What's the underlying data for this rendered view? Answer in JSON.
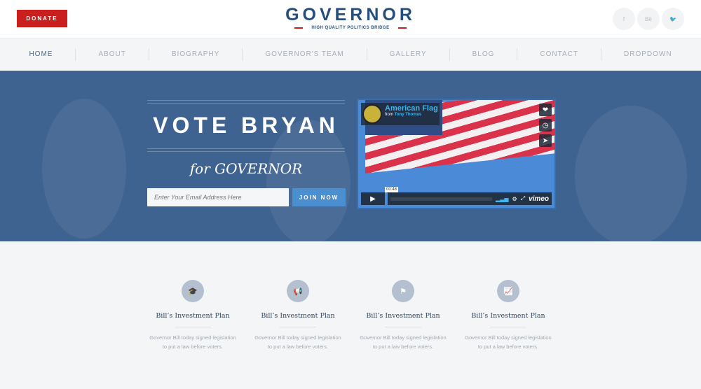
{
  "header": {
    "donate": "DONATE",
    "logo_title": "GOVERNOR",
    "logo_sub": "HIGH QUALITY POLITICS BRIDGE",
    "social": [
      {
        "icon": "facebook-icon",
        "glyph": "f"
      },
      {
        "icon": "behance-icon",
        "glyph": "Bē"
      },
      {
        "icon": "twitter-icon",
        "glyph": "🐦"
      }
    ]
  },
  "nav": [
    "HOME",
    "ABOUT",
    "BIOGRAPHY",
    "GOVERNOR'S TEAM",
    "GALLERY",
    "BLOG",
    "CONTACT",
    "DROPDOWN"
  ],
  "hero": {
    "title": "VOTE BRYAN",
    "subtitle": "for GOVERNOR",
    "email_placeholder": "Enter Your Email Address Here",
    "join": "JOIN NOW"
  },
  "video": {
    "title": "American Flag",
    "from": "from",
    "author": "Tony Thomas",
    "time": "00:48",
    "brand": "vimeo"
  },
  "features": [
    {
      "icon": "graduation-cap-icon",
      "glyph": "🎓",
      "title": "Bill’s Investment Plan",
      "text": "Governor Bill today signed legislation to put a law before voters."
    },
    {
      "icon": "megaphone-icon",
      "glyph": "📢",
      "title": "Bill’s Investment Plan",
      "text": "Governor Bill today signed legislation to put a law before voters."
    },
    {
      "icon": "flag-icon",
      "glyph": "⚑",
      "title": "Bill’s Investment Plan",
      "text": "Governor Bill today signed legislation to put a law before voters."
    },
    {
      "icon": "chart-line-icon",
      "glyph": "📈",
      "title": "Bill’s Investment Plan",
      "text": "Governor Bill today signed legislation to put a law before voters."
    }
  ]
}
